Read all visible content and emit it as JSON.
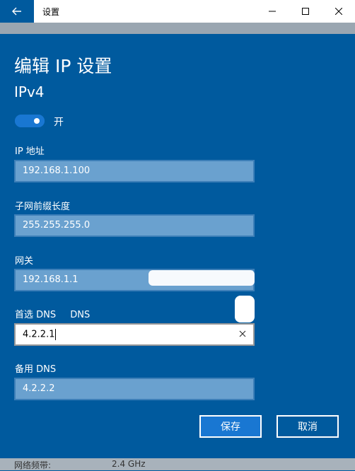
{
  "titlebar": {
    "title": "设置"
  },
  "page": {
    "heading": "编辑 IP 设置",
    "subheading": "IPv4",
    "toggle_label": "开"
  },
  "fields": {
    "ip": {
      "label": "IP 地址",
      "value": "192.168.1.100"
    },
    "subnet": {
      "label": "子网前缀长度",
      "value": "255.255.255.0"
    },
    "gateway": {
      "label": "网关",
      "value": "192.168.1.1"
    },
    "dns_pref": {
      "label": "首选 DNS",
      "label_extra": "DNS",
      "value": "4.2.2.1"
    },
    "dns_alt": {
      "label": "备用 DNS",
      "value": "4.2.2.2"
    }
  },
  "buttons": {
    "save": "保存",
    "cancel": "取消"
  },
  "bottom": {
    "label": "网络频带:",
    "value": "2.4 GHz"
  },
  "colors": {
    "accent": "#005a9e",
    "button": "#1977d2",
    "field": "#6aa1cf"
  },
  "toggle": {
    "on": true
  }
}
